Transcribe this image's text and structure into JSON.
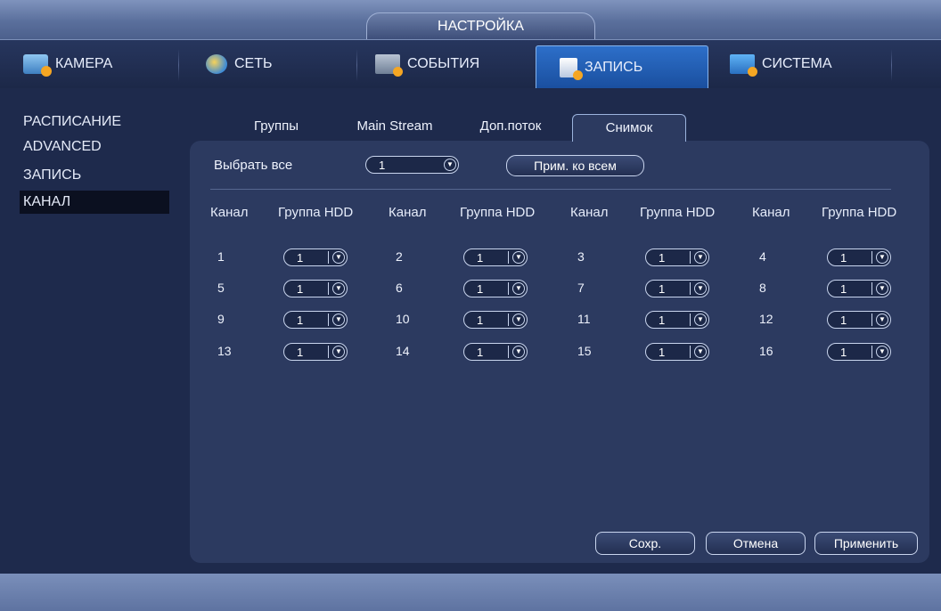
{
  "window": {
    "title": "НАСТРОЙКА"
  },
  "tabs": [
    {
      "label": "КАМЕРА",
      "icon": "camera-icon"
    },
    {
      "label": "СЕТЬ",
      "icon": "network-icon"
    },
    {
      "label": "СОБЫТИЯ",
      "icon": "events-icon"
    },
    {
      "label": "ЗАПИСЬ",
      "icon": "record-icon",
      "active": true
    },
    {
      "label": "СИСТЕМА",
      "icon": "system-icon"
    }
  ],
  "sidebar": {
    "items": [
      {
        "label": "РАСПИСАНИЕ"
      },
      {
        "label": "ADVANCED"
      },
      {
        "label": "ЗАПИСЬ"
      },
      {
        "label": "КАНАЛ",
        "active": true
      }
    ]
  },
  "subtabs": [
    {
      "label": "Группы"
    },
    {
      "label": "Main Stream"
    },
    {
      "label": "Доп.поток"
    },
    {
      "label": "Снимок",
      "active": true
    }
  ],
  "select_all": {
    "label": "Выбрать все",
    "value": "1",
    "apply_all_label": "Прим. ко всем"
  },
  "table": {
    "headers": [
      "Канал",
      "Группа HDD",
      "Канал",
      "Группа HDD",
      "Канал",
      "Группа HDD",
      "Канал",
      "Группа HDD"
    ],
    "rows": [
      {
        "channels": [
          "1",
          "2",
          "3",
          "4"
        ],
        "groups": [
          "1",
          "1",
          "1",
          "1"
        ]
      },
      {
        "channels": [
          "5",
          "6",
          "7",
          "8"
        ],
        "groups": [
          "1",
          "1",
          "1",
          "1"
        ]
      },
      {
        "channels": [
          "9",
          "10",
          "11",
          "12"
        ],
        "groups": [
          "1",
          "1",
          "1",
          "1"
        ]
      },
      {
        "channels": [
          "13",
          "14",
          "15",
          "16"
        ],
        "groups": [
          "1",
          "1",
          "1",
          "1"
        ]
      }
    ]
  },
  "buttons": {
    "save": "Сохр.",
    "cancel": "Отмена",
    "apply": "Применить"
  },
  "colors": {
    "active_tab": "#1f5db5",
    "panel": "#2c3a60",
    "background": "#1e2a4c"
  }
}
